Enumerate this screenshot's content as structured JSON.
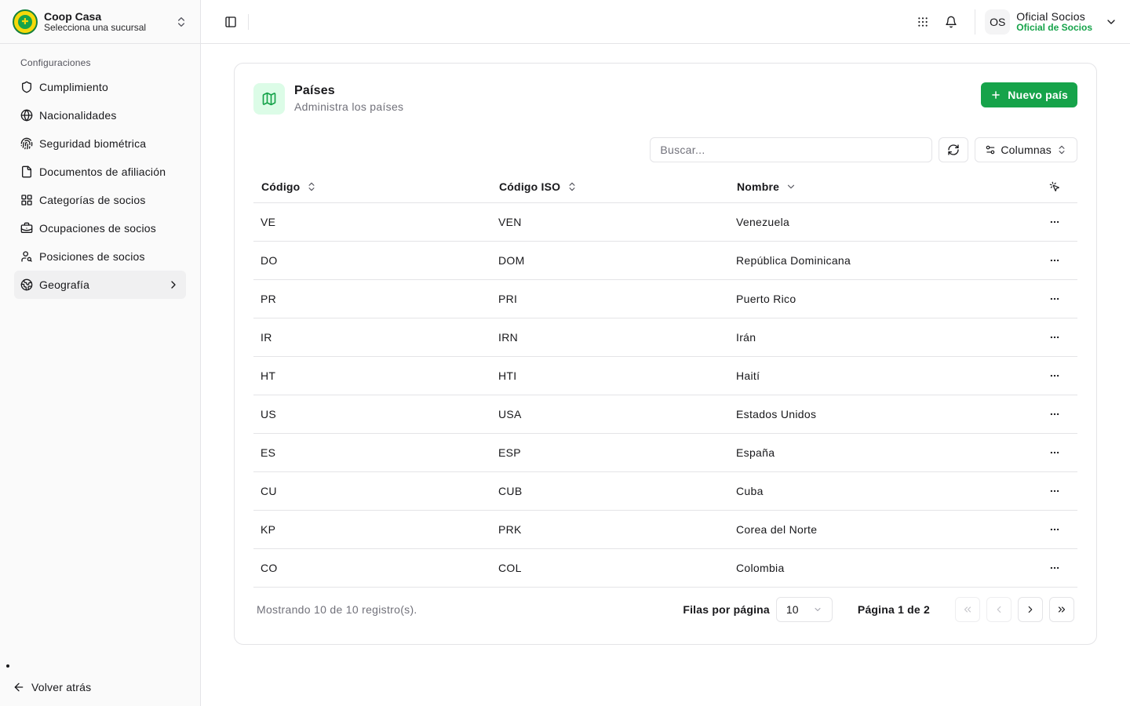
{
  "brand": {
    "name": "Coop Casa",
    "subtitle": "Selecciona una sucursal"
  },
  "sidebar": {
    "section_label": "Configuraciones",
    "items": [
      {
        "label": "Cumplimiento",
        "icon": "shield-icon"
      },
      {
        "label": "Nacionalidades",
        "icon": "globe-icon"
      },
      {
        "label": "Seguridad biométrica",
        "icon": "fingerprint-icon"
      },
      {
        "label": "Documentos de afiliación",
        "icon": "file-icon"
      },
      {
        "label": "Categorías de socios",
        "icon": "grid-icon"
      },
      {
        "label": "Ocupaciones de socios",
        "icon": "briefcase-icon"
      },
      {
        "label": "Posiciones de socios",
        "icon": "users-icon"
      },
      {
        "label": "Geografía",
        "icon": "earth-icon",
        "active": true
      }
    ],
    "back_label": "Volver atrás"
  },
  "topbar": {
    "user_initials": "OS",
    "user_name": "Oficial Socios",
    "user_role": "Oficial de Socios"
  },
  "page": {
    "title": "Países",
    "subtitle": "Administra los países",
    "new_button": "Nuevo país",
    "search_placeholder": "Buscar...",
    "columns_button": "Columnas"
  },
  "table": {
    "headers": [
      "Código",
      "Código ISO",
      "Nombre"
    ],
    "rows": [
      [
        "VE",
        "VEN",
        "Venezuela"
      ],
      [
        "DO",
        "DOM",
        "República Dominicana"
      ],
      [
        "PR",
        "PRI",
        "Puerto Rico"
      ],
      [
        "IR",
        "IRN",
        "Irán"
      ],
      [
        "HT",
        "HTI",
        "Haití"
      ],
      [
        "US",
        "USA",
        "Estados Unidos"
      ],
      [
        "ES",
        "ESP",
        "España"
      ],
      [
        "CU",
        "CUB",
        "Cuba"
      ],
      [
        "KP",
        "PRK",
        "Corea del Norte"
      ],
      [
        "CO",
        "COL",
        "Colombia"
      ]
    ]
  },
  "footer": {
    "count_text": "Mostrando 10 de 10 registro(s).",
    "rows_per_page_label": "Filas por página",
    "rows_per_page_value": "10",
    "page_text": "Página 1 de 2"
  },
  "colors": {
    "accent": "#16a34a",
    "accent_soft": "#dcfce7",
    "border": "#e4e4e7",
    "muted_text": "#71717a"
  }
}
